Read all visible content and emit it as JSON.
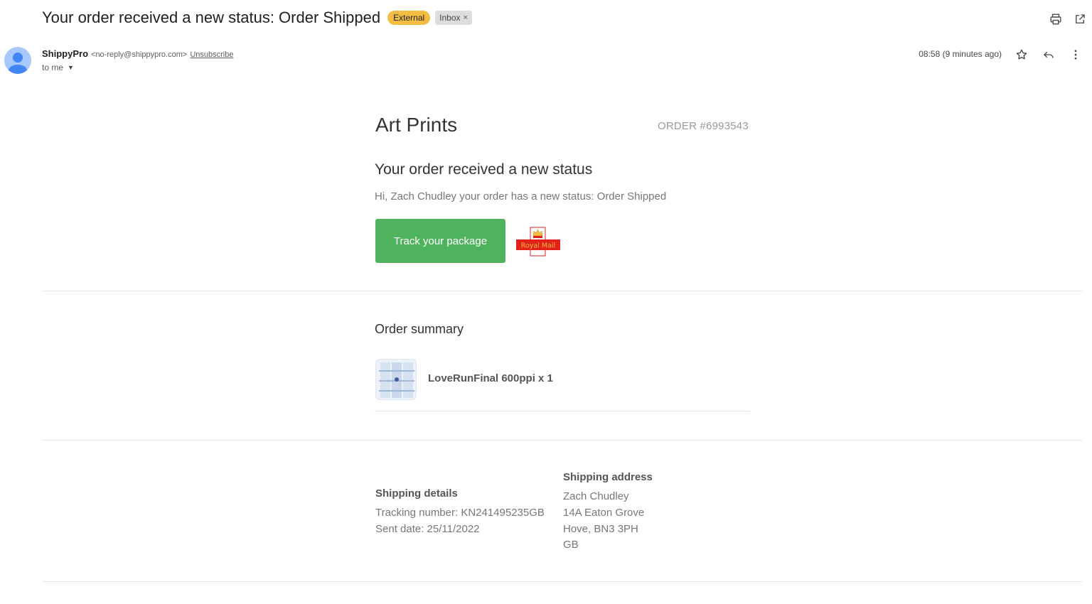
{
  "email": {
    "subject": "Your order received a new status: Order Shipped",
    "labels": {
      "external": "External",
      "inbox": "Inbox",
      "inbox_remove": "×"
    },
    "sender": {
      "name": "ShippyPro",
      "email": "<no-reply@shippypro.com>",
      "unsubscribe": "Unsubscribe"
    },
    "to": "to me",
    "time": "08:58 (9 minutes ago)",
    "icons": [
      "print-icon",
      "open-in-new-window-icon",
      "star-icon",
      "reply-icon",
      "more-vert-icon"
    ]
  },
  "body": {
    "shop_name": "Art Prints",
    "order_number": "ORDER #6993543",
    "status_heading": "Your order received a new status",
    "status_message": "Hi, Zach Chudley your order has a new status: Order Shipped",
    "track_button": "Track your package",
    "carrier_logo_text": "Royal Mail",
    "order_summary": {
      "heading": "Order summary",
      "items": [
        {
          "name": "LoveRunFinal 600ppi x 1"
        }
      ]
    },
    "shipping_details": {
      "title": "Shipping details",
      "tracking": "Tracking number: KN241495235GB",
      "sent_date": "Sent date: 25/11/2022"
    },
    "shipping_address": {
      "title": "Shipping address",
      "lines": [
        "Zach Chudley",
        "14A Eaton Grove",
        "Hove, BN3 3PH",
        "GB"
      ]
    }
  },
  "colors": {
    "track_button": "#4fb35d",
    "external_badge": "#f2bd42",
    "royal_mail_red": "#e32119"
  }
}
